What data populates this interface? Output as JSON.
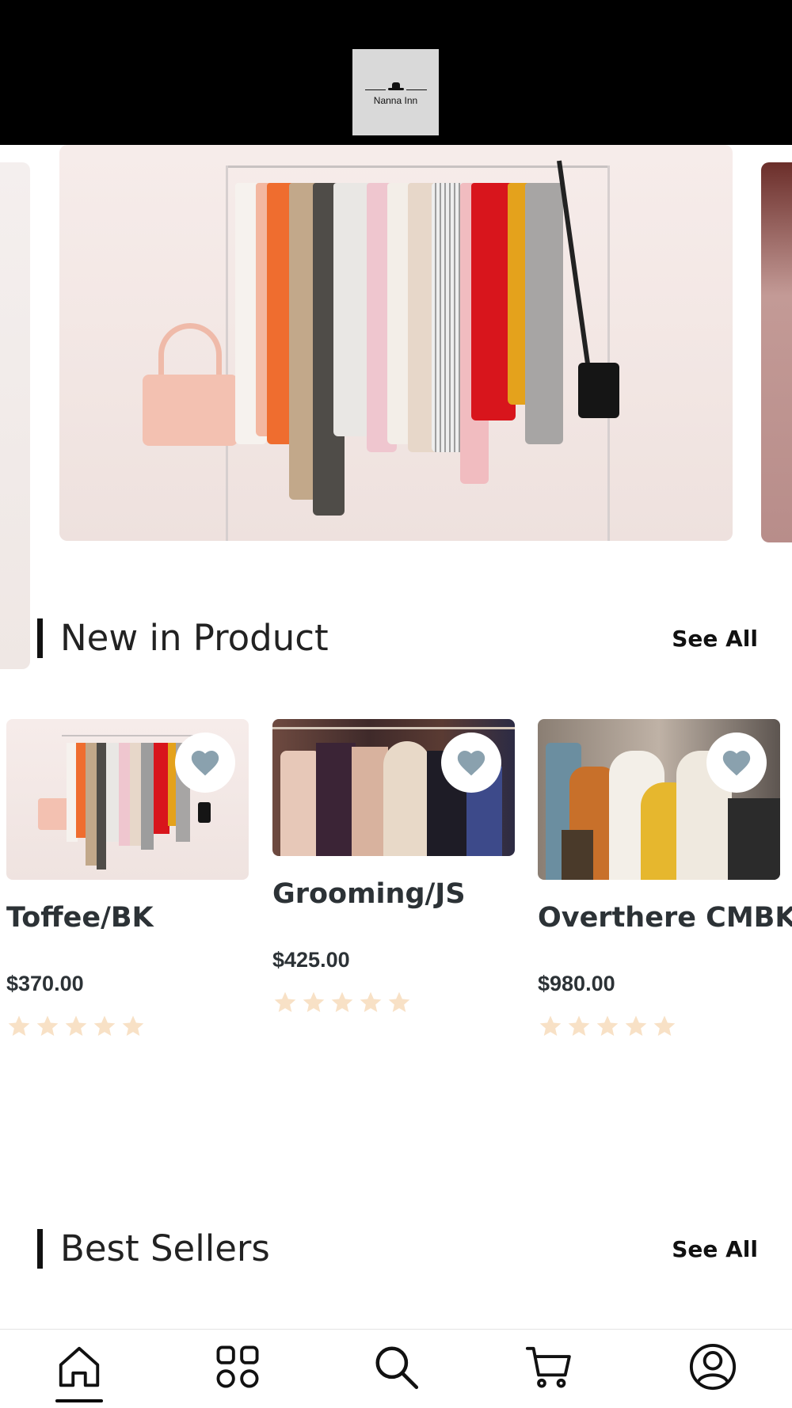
{
  "header": {
    "logo_text": "Nanna Inn"
  },
  "carousel": {
    "slides": [
      "handbags-slide",
      "clothes-rack-slide",
      "boutique-slide"
    ]
  },
  "sections": {
    "new_in": {
      "title": "New in Product",
      "see_all": "See All"
    },
    "best_sellers": {
      "title": "Best Sellers",
      "see_all": "See All"
    }
  },
  "products": [
    {
      "name": "Toffee/BK",
      "price": "$370.00",
      "rating": 5
    },
    {
      "name": "Grooming/JS",
      "price": "$425.00",
      "rating": 5
    },
    {
      "name": "Overthere CMBK",
      "price": "$980.00",
      "rating": 5
    }
  ],
  "colors": {
    "header_bg": "#000000",
    "favorite_heart": "#8aa1ae",
    "star": "#f8e1c6",
    "text_dark": "#2c3236"
  },
  "bottom_nav": {
    "items": [
      "home-icon",
      "categories-icon",
      "search-icon",
      "cart-icon",
      "profile-icon"
    ],
    "active": "home-icon"
  }
}
